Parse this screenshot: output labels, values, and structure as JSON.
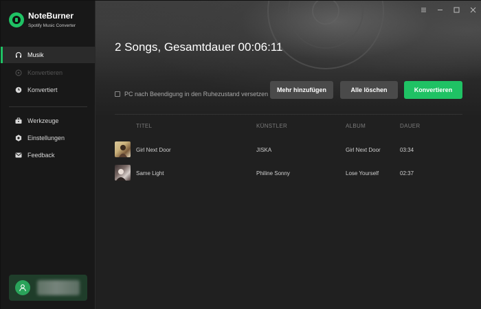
{
  "app": {
    "name": "NoteBurner",
    "subtitle": "Spotify Music Converter"
  },
  "sidebar": {
    "items": [
      {
        "label": "Musik",
        "icon": "headphones-icon",
        "state": "active"
      },
      {
        "label": "Konvertieren",
        "icon": "convert-icon",
        "state": "disabled"
      },
      {
        "label": "Konvertiert",
        "icon": "clock-icon",
        "state": "normal"
      },
      {
        "label": "Werkzeuge",
        "icon": "toolbox-icon",
        "state": "normal"
      },
      {
        "label": "Einstellungen",
        "icon": "gear-icon",
        "state": "normal"
      },
      {
        "label": "Feedback",
        "icon": "mail-icon",
        "state": "normal"
      }
    ]
  },
  "main": {
    "title": "2 Songs, Gesamtdauer 00:06:11",
    "sleep_option": "PC nach Beendigung in den Ruhezustand versetzen",
    "buttons": {
      "add": "Mehr hinzufügen",
      "clear": "Alle löschen",
      "convert": "Konvertieren"
    },
    "table": {
      "headers": {
        "title": "TITEL",
        "artist": "KÜNSTLER",
        "album": "ALBUM",
        "duration": "DAUER"
      },
      "rows": [
        {
          "title": "Girl Next Door",
          "artist": "JISKA",
          "album": "Girl Next Door",
          "duration": "03:34"
        },
        {
          "title": "Same Light",
          "artist": "Philine Sonny",
          "album": "Lose Yourself",
          "duration": "02:37"
        }
      ]
    }
  },
  "colors": {
    "accent": "#1fc264",
    "background": "#202020",
    "sidebar": "#181818"
  }
}
